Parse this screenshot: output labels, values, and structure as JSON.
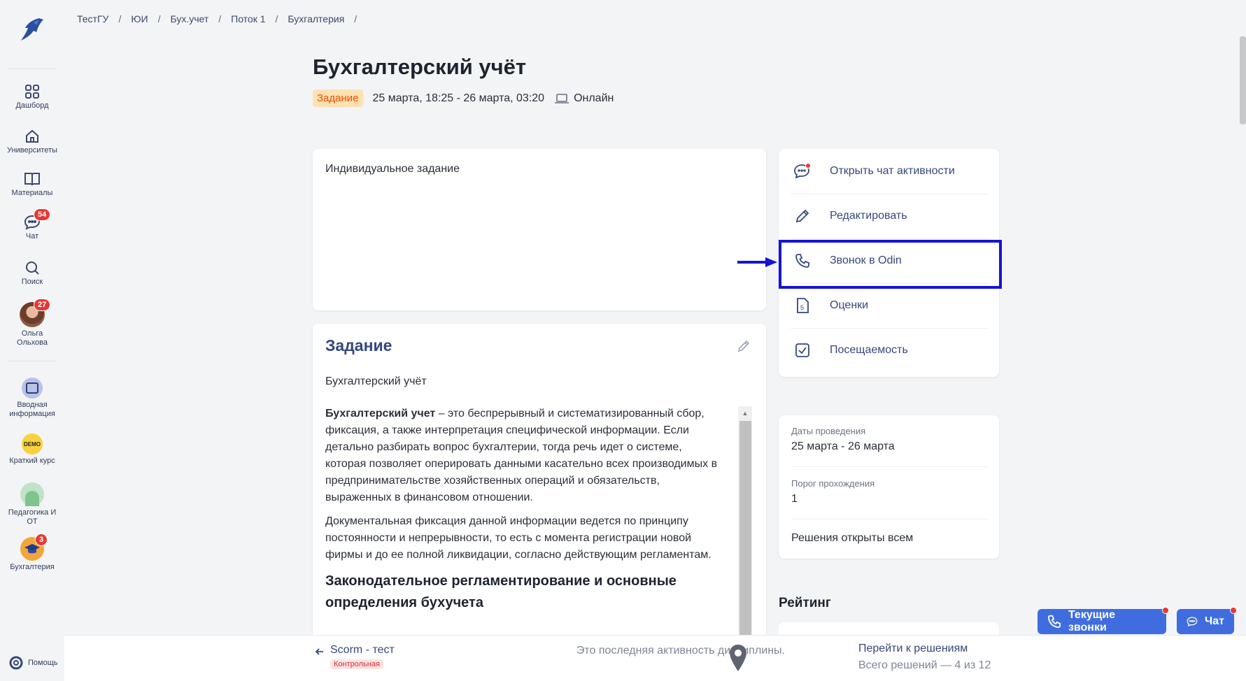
{
  "sidebar": {
    "items": [
      {
        "label": "Дашборд",
        "icon": "grid-icon"
      },
      {
        "label": "Университеты",
        "icon": "home-icon"
      },
      {
        "label": "Материалы",
        "icon": "book-icon"
      },
      {
        "label": "Чат",
        "icon": "chat-icon",
        "badge": "54"
      },
      {
        "label": "Поиск",
        "icon": "search-icon"
      },
      {
        "label": "Ольга Ольхова",
        "icon": "avatar",
        "badge": "27"
      }
    ],
    "courses": [
      {
        "label": "Вводная информация",
        "icon": "course-intro-icon"
      },
      {
        "label": "Краткий курс",
        "icon": "demo-icon"
      },
      {
        "label": "Педагогика И ОТ",
        "icon": "people-icon"
      },
      {
        "label": "Бухгалтерия",
        "icon": "graduation-cap-icon",
        "badge": "3"
      }
    ],
    "help": "Помощь"
  },
  "breadcrumb": [
    "ТестГУ",
    "ЮИ",
    "Бух.учет",
    "Поток 1",
    "Бухгалтерия"
  ],
  "breadcrumb_sep": "/",
  "page": {
    "title": "Бухгалтерский учёт",
    "tag": "Задание",
    "dates": "25 марта, 18:25 - 26 марта, 03:20",
    "mode": "Онлайн"
  },
  "description": "Индивидуальное задание",
  "task": {
    "title": "Задание",
    "subtitle": "Бухгалтерский учёт",
    "p1_bold": "Бухгалтерский учет",
    "p1_rest": " – это беспрерывный и систематизированный сбор, фиксация, а также интерпретация специфической информации. Если детально разбирать вопрос бухгалтерии, тогда речь идет о системе, которая позволяет оперировать данными касательно всех производимых в предпринимательстве хозяйственных операций и обязательств, выраженных в финансовом отношении.",
    "p2": "Документальная фиксация данной информации ведется по принципу постоянности и непрерывности, то есть с момента регистрации новой фирмы и до ее полной ликвидации, согласно действующим регламентам.",
    "h3": "Законодательное регламентирование и основные определения бухучета"
  },
  "actions": [
    {
      "label": "Открыть чат активности",
      "icon": "chat-activity-icon"
    },
    {
      "label": "Редактировать",
      "icon": "pencil-icon"
    },
    {
      "label": "Звонок в Odin",
      "icon": "phone-icon"
    },
    {
      "label": "Оценки",
      "icon": "grades-icon"
    },
    {
      "label": "Посещаемость",
      "icon": "checkbox-icon"
    }
  ],
  "info": {
    "dates_label": "Даты проведения",
    "dates_value": "25 марта - 26 марта",
    "threshold_label": "Порог прохождения",
    "threshold_value": "1",
    "solutions": "Решения открыты всем"
  },
  "rating_title": "Рейтинг",
  "bottom": {
    "prev_title": "Scorm - тест",
    "prev_tag": "Контрольная",
    "last_note": "Это последняя активность дисциплины.",
    "next_title": "Перейти к решениям",
    "next_sub": "Всего решений — 4 из 12"
  },
  "floating": {
    "calls": "Текущие звонки",
    "chat": "Чат"
  },
  "colors": {
    "accent": "#3f6de0",
    "link": "#35487d",
    "highlight": "#1414d6",
    "badge": "#e53935",
    "tag_bg": "#ffe0b2",
    "tag_fg": "#e65100"
  }
}
